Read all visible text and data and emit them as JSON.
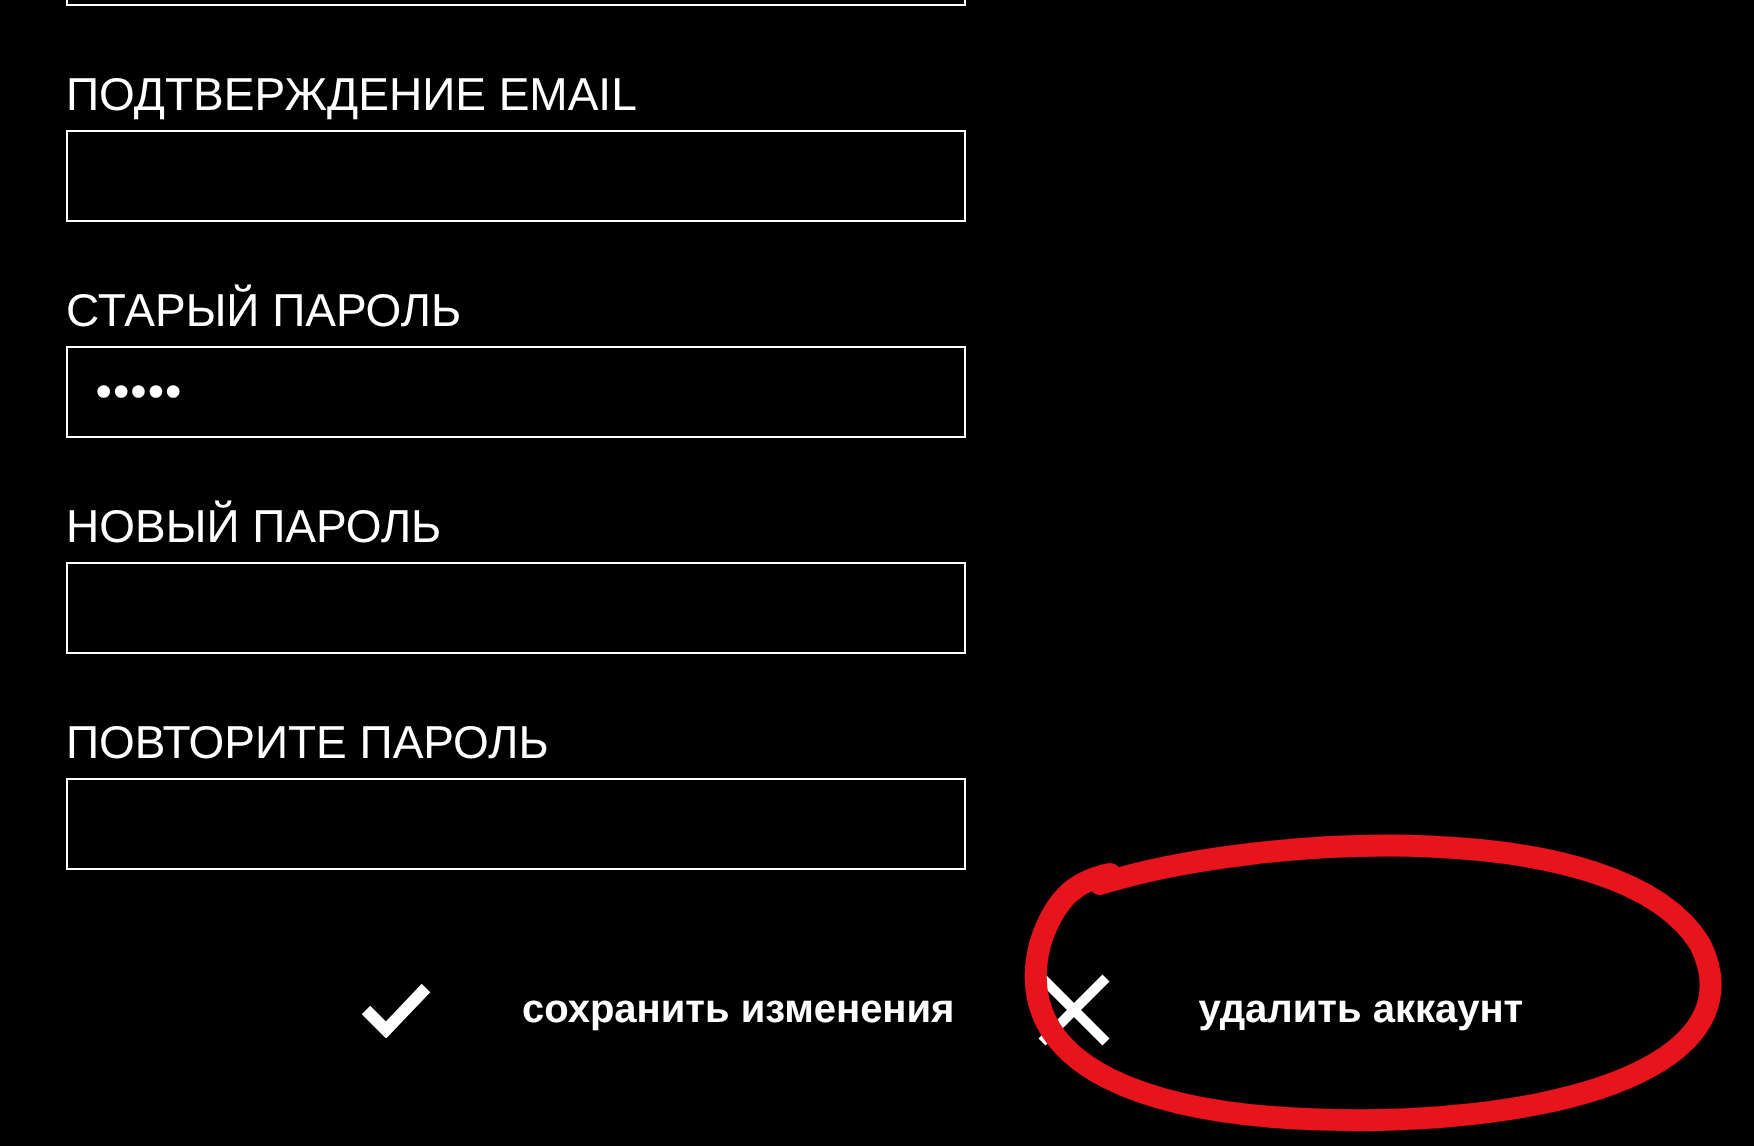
{
  "fields": [
    {
      "kind": "cut"
    },
    {
      "kind": "field",
      "label": "ПОДТВЕРЖДЕНИЕ EMAIL"
    },
    {
      "kind": "field",
      "label": "СТАРЫЙ ПАРОЛЬ",
      "value": "•••••"
    },
    {
      "kind": "field",
      "label": "НОВЫЙ ПАРОЛЬ"
    },
    {
      "kind": "field",
      "label": "ПОВТОРИТЕ ПАРОЛЬ"
    }
  ],
  "buttons": [
    {
      "kind": "save",
      "label": "сохранить изменения"
    },
    {
      "kind": "delete",
      "label": "удалить аккаунт"
    }
  ],
  "annotation": {
    "kind": "scribble"
  }
}
